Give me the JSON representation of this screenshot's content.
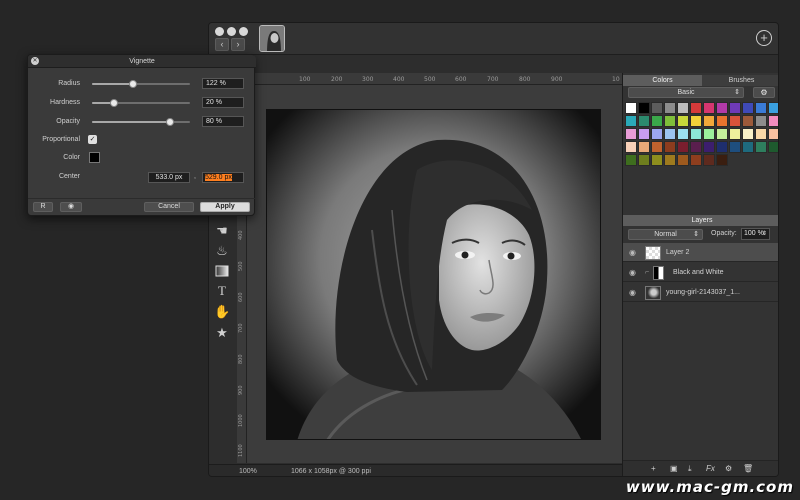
{
  "ruler": {
    "top_ticks": [
      "0",
      "100",
      "200",
      "300",
      "400",
      "500",
      "600",
      "700",
      "800",
      "900",
      "10"
    ],
    "left_ticks": [
      "100",
      "200",
      "300",
      "400",
      "500",
      "600",
      "700",
      "800",
      "900",
      "1000",
      "1100"
    ]
  },
  "status": {
    "zoom": "100%",
    "doc_info": "1066 x 1058px @ 300 ppi"
  },
  "panels": {
    "tab_colors": "Colors",
    "tab_brushes": "Brushes",
    "palette_select": "Basic",
    "layers_header": "Layers",
    "blend_mode": "Normal",
    "opacity_label": "Opacity:",
    "opacity_value": "100 %"
  },
  "swatch_colors": [
    "#ffffff",
    "#000000",
    "#5c5c5c",
    "#8c8c8c",
    "#bdbdbd",
    "#d63a3a",
    "#d6366f",
    "#b23aa8",
    "#6f3ab6",
    "#3f4ab8",
    "#3a7bd6",
    "#3aa0e0",
    "#2aa9b8",
    "#2c8a6e",
    "#3aa84a",
    "#7fbf3a",
    "#c8d83a",
    "#f2d23a",
    "#f2a83a",
    "#e8742e",
    "#d9533a",
    "#9c5a3a",
    "#8c8c8c",
    "#f28cbf",
    "#e89cd6",
    "#c89cf0",
    "#9ca6f0",
    "#9cc4f0",
    "#9ce0f0",
    "#8ce6d6",
    "#9cf09c",
    "#c4f09c",
    "#eef09c",
    "#f8f0c8",
    "#f8d8a8",
    "#f8c0a0",
    "#f8d0b8",
    "#e8a878",
    "#c0622e",
    "#8c3c1e",
    "#7a1e2e",
    "#5a1e4e",
    "#3c1e6e",
    "#1e2e6e",
    "#1e4e7e",
    "#1e6a7e",
    "#2e7e5e",
    "#1e5a2e",
    "#3e6e1e",
    "#6e7e1e",
    "#8e8e1e",
    "#9e7a1e",
    "#9e5a1e",
    "#8e3e1e",
    "#5e2a1e",
    "#3a1e10"
  ],
  "layers": [
    {
      "name": "Layer 2",
      "selected": true
    },
    {
      "name": "Black and White",
      "selected": false
    },
    {
      "name": "young-girl-2143037_1...",
      "selected": false
    }
  ],
  "vignette": {
    "title": "Vignette",
    "radius_label": "Radius",
    "radius_value": "122 %",
    "radius_level": 0.42,
    "hardness_label": "Hardness",
    "hardness_value": "20 %",
    "hardness_level": 0.22,
    "opacity_label": "Opacity",
    "opacity_value": "80 %",
    "opacity_level": 0.8,
    "proportional_label": "Proportional",
    "color_label": "Color",
    "center_label": "Center",
    "center_x": "533.0 px",
    "center_sep": ",",
    "center_y": "529.0 px",
    "reset_label": "R",
    "cancel_label": "Cancel",
    "apply_label": "Apply"
  },
  "watermark": "www.mac-gm.com"
}
